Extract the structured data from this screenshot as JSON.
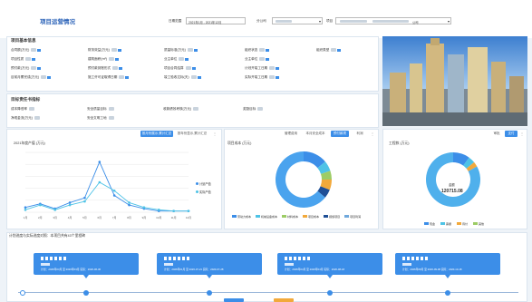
{
  "header": {
    "title": "项目运营情况",
    "date_label": "日期范围",
    "date_value": "2021年1月 - 2021年12月",
    "company_label": "分公司",
    "project_label": "项目",
    "company_suffix": "公司"
  },
  "basic": {
    "title": "项目基本信息",
    "fields": [
      [
        "合同额(万元)",
        "财务效益(万元)",
        "质量标准(万元)",
        "组织状态",
        "组织类型"
      ],
      [
        "项目性质",
        "建筑面积(m²)",
        "业主单位",
        "业主单位"
      ],
      [
        "预付款(万元)",
        "预付款到账形式",
        "项目合同结算",
        "计划开竣工日期"
      ],
      [
        "目前月累完成(万元)",
        "施工许可证取得日期",
        "竣工验收达标(天)",
        "实际开竣工日期"
      ]
    ]
  },
  "resp": {
    "title": "目标责任书指标",
    "fields": [
      [
        "成本降低率",
        "安全质量目标",
        "收款绩效考核(万元)",
        "奖励目标"
      ],
      [
        "净现金流(万元)",
        "安全文明工地"
      ]
    ]
  },
  "chart1": {
    "tabs": [
      "按月份展示,累计汇总",
      "按年份显示,累计汇总"
    ],
    "title": "2021年度产值 (万元)",
    "legend": [
      "计划产值",
      "实际产值"
    ]
  },
  "chart2": {
    "tabs": [
      "管理费用",
      "本月安全成本",
      "预付款项",
      "利润"
    ],
    "title": "项目成本 (万元)",
    "center_label": "项目成本",
    "center_value": "14468.38",
    "legend": [
      "劳动力成本",
      "机械设备成本",
      "材料成本",
      "项目成本",
      "措施项目",
      "项目利润"
    ]
  },
  "chart3": {
    "tabs": [
      "审批",
      "支付"
    ],
    "title": "工程款 (万元)",
    "center_label": "金额",
    "center_value": "120715.08",
    "legend": [
      "现金",
      "票据",
      "待付",
      "其他"
    ]
  },
  "plan": {
    "title": "计划进度与实际进度对照：本项目共有43个里程碑",
    "cards": [
      "计划：2026年03月 至 2020年03月 实际：2020-06-30",
      "计划：2026年01月 至 2026-07-21 实际：2020-07-28",
      "计划：2026年04月 至 2026年04月 实际：2020-08-18",
      "计划：2026年08月 至 2026-09-08 实际：2020-10-18"
    ]
  },
  "chart_data": {
    "type": "line",
    "title": "2021年度产值 (万元)",
    "categories": [
      "1月",
      "2月",
      "3月",
      "4月",
      "5月",
      "6月",
      "7月",
      "8月",
      "9月",
      "10月",
      "11月",
      "12月"
    ],
    "series": [
      {
        "name": "计划产值",
        "values": [
          4,
          7,
          3,
          8,
          12,
          42,
          14,
          6,
          3,
          1,
          1,
          1
        ]
      },
      {
        "name": "实际产值",
        "values": [
          2,
          6,
          2,
          6,
          9,
          25,
          18,
          8,
          4,
          2,
          1,
          1
        ]
      }
    ],
    "ylim": [
      0,
      50
    ]
  },
  "pie1": {
    "values": [
      14,
      6,
      5,
      6,
      5,
      64
    ]
  },
  "pie2": {
    "values": [
      10,
      4,
      3,
      83
    ]
  },
  "colors": {
    "blue": "#3c8ee8",
    "teal": "#4ec3e6",
    "header": "#2c63b8",
    "orange": "#f2a93b",
    "green": "#9ccc65"
  }
}
